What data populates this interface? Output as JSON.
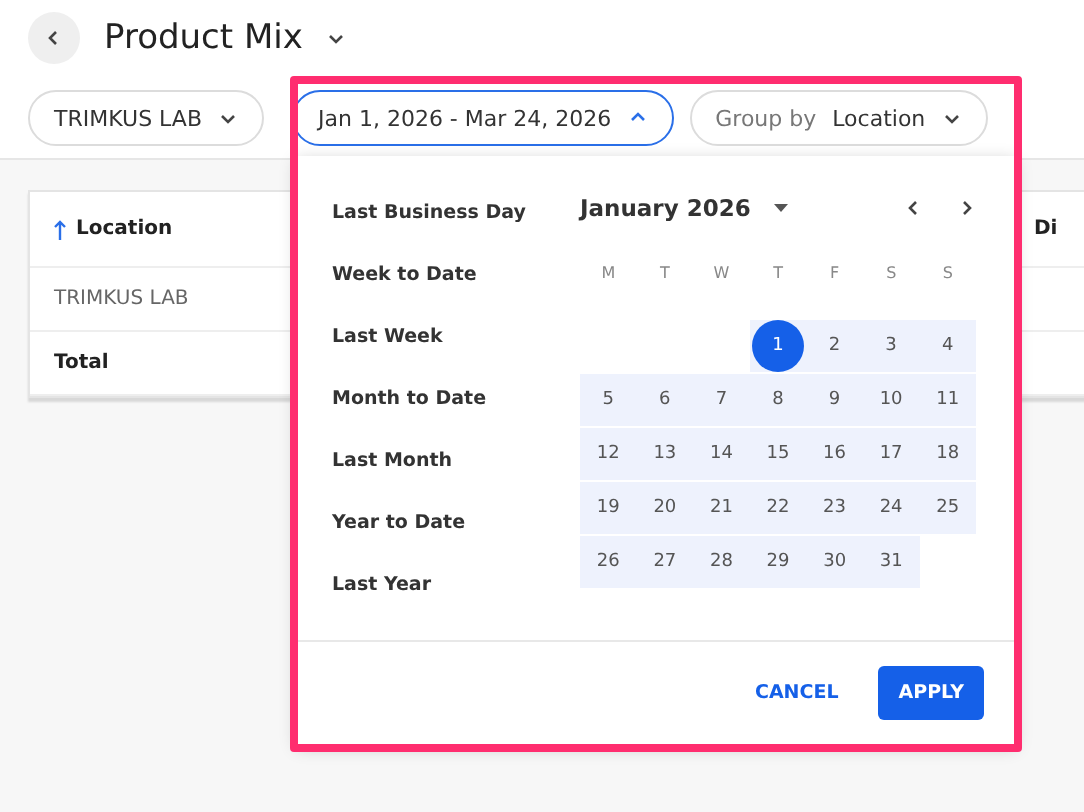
{
  "header": {
    "title": "Product Mix"
  },
  "filters": {
    "location": "TRIMKUS LAB",
    "date_range": {
      "label": "Jan 1, 2026 - Mar 24, 2026",
      "expanded": true
    },
    "group_by": {
      "label": "Group by",
      "value": "Location"
    }
  },
  "table": {
    "columns": [
      {
        "label": "Location",
        "sorted": true
      },
      {
        "label": "Di",
        "sorted": false
      }
    ],
    "rows": [
      {
        "kind": "data",
        "cells": [
          "TRIMKUS LAB"
        ]
      },
      {
        "kind": "total",
        "cells": [
          "Total"
        ]
      }
    ]
  },
  "date_picker": {
    "presets": [
      {
        "label": "Last Business Day",
        "selected": false
      },
      {
        "label": "Week to Date",
        "selected": false
      },
      {
        "label": "Last Week",
        "selected": false
      },
      {
        "label": "Month to Date",
        "selected": false
      },
      {
        "label": "Last Month",
        "selected": false
      },
      {
        "label": "Year to Date",
        "selected": false
      },
      {
        "label": "Last Year",
        "selected": false
      }
    ],
    "month_label": "January 2026",
    "weekdays": [
      "M",
      "T",
      "W",
      "T",
      "F",
      "S",
      "S"
    ],
    "weeks": [
      {
        "kind": "first",
        "days": [
          {
            "day": "1",
            "selected": true,
            "in_range": true
          },
          {
            "day": "2",
            "selected": false,
            "in_range": true
          },
          {
            "day": "3",
            "selected": false,
            "in_range": true
          },
          {
            "day": "4",
            "selected": false,
            "in_range": true
          }
        ]
      },
      {
        "kind": "full",
        "days": [
          {
            "day": "5",
            "selected": false,
            "in_range": true
          },
          {
            "day": "6",
            "selected": false,
            "in_range": true
          },
          {
            "day": "7",
            "selected": false,
            "in_range": true
          },
          {
            "day": "8",
            "selected": false,
            "in_range": true
          },
          {
            "day": "9",
            "selected": false,
            "in_range": true
          },
          {
            "day": "10",
            "selected": false,
            "in_range": true
          },
          {
            "day": "11",
            "selected": false,
            "in_range": true
          }
        ]
      },
      {
        "kind": "full",
        "days": [
          {
            "day": "12",
            "selected": false,
            "in_range": true
          },
          {
            "day": "13",
            "selected": false,
            "in_range": true
          },
          {
            "day": "14",
            "selected": false,
            "in_range": true
          },
          {
            "day": "15",
            "selected": false,
            "in_range": true
          },
          {
            "day": "16",
            "selected": false,
            "in_range": true
          },
          {
            "day": "17",
            "selected": false,
            "in_range": true
          },
          {
            "day": "18",
            "selected": false,
            "in_range": true
          }
        ]
      },
      {
        "kind": "full",
        "days": [
          {
            "day": "19",
            "selected": false,
            "in_range": true
          },
          {
            "day": "20",
            "selected": false,
            "in_range": true
          },
          {
            "day": "21",
            "selected": false,
            "in_range": true
          },
          {
            "day": "22",
            "selected": false,
            "in_range": true
          },
          {
            "day": "23",
            "selected": false,
            "in_range": true
          },
          {
            "day": "24",
            "selected": false,
            "in_range": true
          },
          {
            "day": "25",
            "selected": false,
            "in_range": true
          }
        ]
      },
      {
        "kind": "last",
        "days": [
          {
            "day": "26",
            "selected": false,
            "in_range": true
          },
          {
            "day": "27",
            "selected": false,
            "in_range": true
          },
          {
            "day": "28",
            "selected": false,
            "in_range": true
          },
          {
            "day": "29",
            "selected": false,
            "in_range": true
          },
          {
            "day": "30",
            "selected": false,
            "in_range": true
          },
          {
            "day": "31",
            "selected": false,
            "in_range": true
          }
        ]
      }
    ],
    "buttons": [
      {
        "label": "CANCEL",
        "kind": "text"
      },
      {
        "label": "APPLY",
        "kind": "primary"
      }
    ]
  }
}
